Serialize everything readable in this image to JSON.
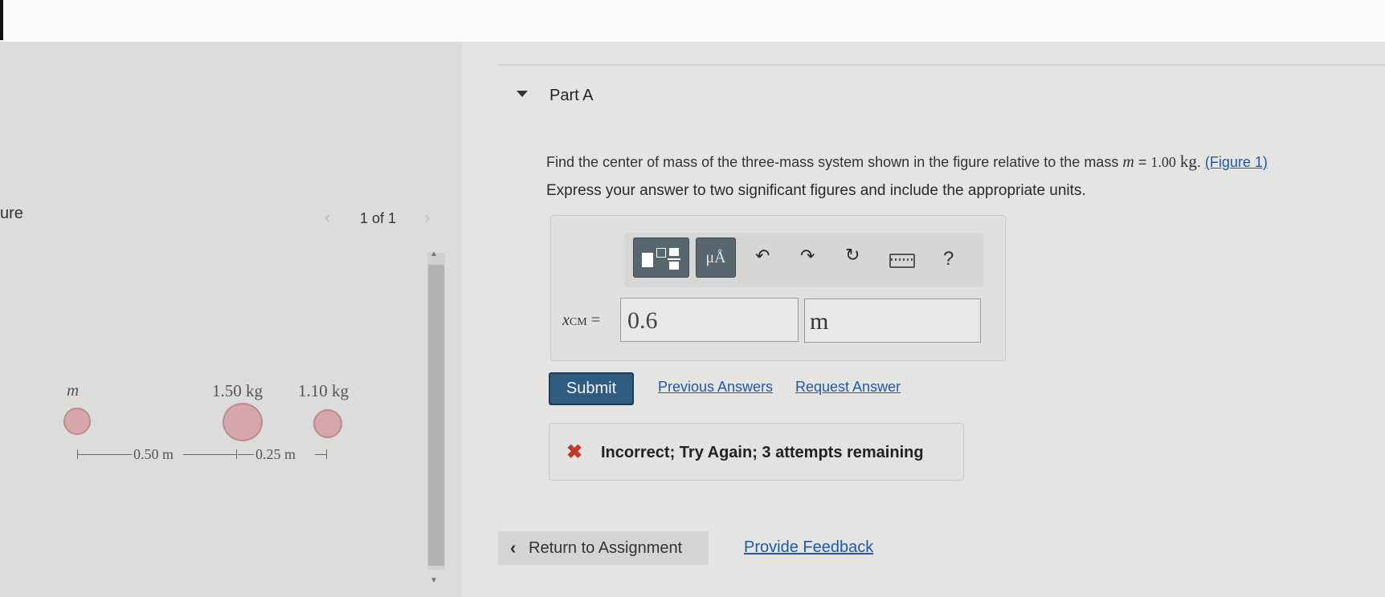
{
  "figure_panel": {
    "title": "ure",
    "pager": {
      "prev_glyph": "‹",
      "count": "1 of 1",
      "next_glyph": "›"
    },
    "figure": {
      "mass_labels": [
        "m",
        "1.50 kg",
        "1.10 kg"
      ],
      "distances": [
        "0.50 m",
        "0.25 m"
      ]
    }
  },
  "part": {
    "title": "Part A",
    "question": {
      "text": "Find the center of mass of the three-mass system shown in the figure relative to the mass",
      "variable": "m",
      "equals": "=",
      "value": "1.00",
      "unit": "kg",
      "separator": ".",
      "figure_link": "(Figure 1)"
    },
    "instruction": "Express your answer to two significant figures and include the appropriate units.",
    "toolbar": {
      "units_label": "μÅ",
      "undo_glyph": "↶",
      "redo_glyph": "↷",
      "reset_glyph": "↻",
      "help_label": "?"
    },
    "answer": {
      "variable_main": "x",
      "variable_sub": "CM",
      "equals": "=",
      "value": "0.6",
      "unit": "m"
    },
    "actions": {
      "submit": "Submit",
      "previous_answers": "Previous Answers",
      "request_answer": "Request Answer"
    },
    "feedback": {
      "icon": "✖",
      "text": "Incorrect; Try Again; 3 attempts remaining",
      "color": "#c0392b"
    }
  },
  "footer": {
    "return_glyph": "‹",
    "return_label": "Return to Assignment",
    "provide_feedback": "Provide Feedback"
  },
  "colors": {
    "submit_bg": "#2f5d82",
    "link": "#1f5aa8",
    "ball": "#d6a6ab"
  }
}
